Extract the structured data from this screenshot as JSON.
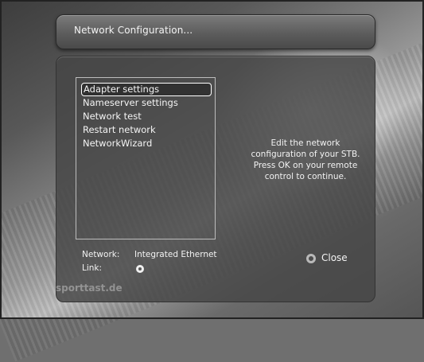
{
  "header": {
    "title": "Network Configuration..."
  },
  "menu": {
    "selected_index": 0,
    "items": [
      {
        "label": "Adapter settings"
      },
      {
        "label": "Nameserver settings"
      },
      {
        "label": "Network test"
      },
      {
        "label": "Restart network"
      },
      {
        "label": "NetworkWizard"
      }
    ]
  },
  "help": {
    "lines": [
      "Edit the network",
      "configuration of your STB.",
      "Press OK on your remote",
      "control to continue."
    ]
  },
  "status": {
    "network_label": "Network:",
    "network_value": "Integrated Ethernet",
    "link_label": "Link:"
  },
  "buttons": {
    "close_label": "Close"
  },
  "watermark": "sporttast.de",
  "colors": {
    "panel": "#464646",
    "text": "#f4f4f4",
    "close_button_ring": "#b9b9b9"
  }
}
